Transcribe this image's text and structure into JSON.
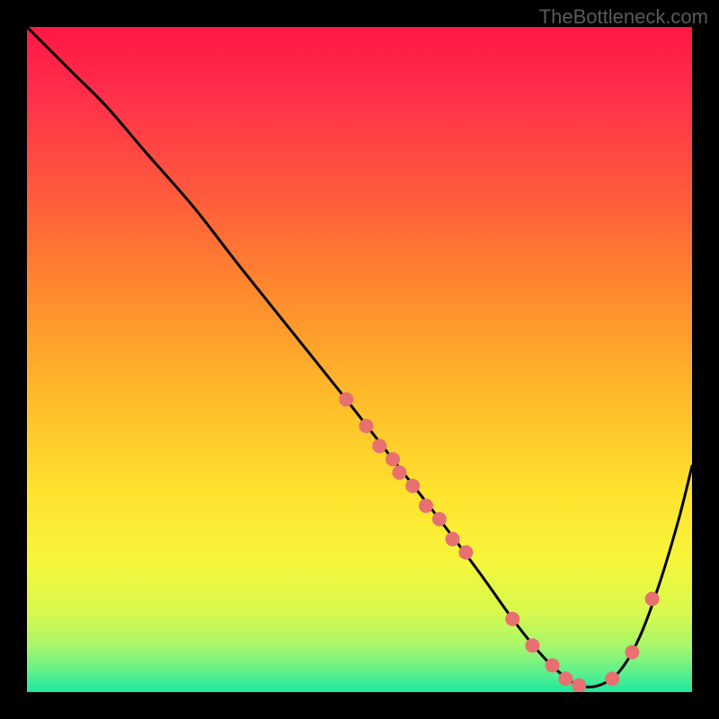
{
  "watermark": "TheBottleneck.com",
  "chart_data": {
    "type": "line",
    "title": "",
    "xlabel": "",
    "ylabel": "",
    "xlim": [
      0,
      100
    ],
    "ylim": [
      0,
      100
    ],
    "series": [
      {
        "name": "curve",
        "x": [
          0,
          3,
          7,
          12,
          18,
          25,
          32,
          40,
          48,
          55,
          62,
          68,
          73,
          77,
          80,
          83,
          86,
          89,
          92,
          95,
          98,
          100
        ],
        "y": [
          100,
          97,
          93,
          88,
          81,
          73,
          64,
          54,
          44,
          35,
          26,
          18,
          11,
          6,
          3,
          1,
          1,
          3,
          8,
          16,
          26,
          34
        ]
      }
    ],
    "markers": {
      "name": "highlight-points",
      "x": [
        48,
        51,
        53,
        55,
        56,
        58,
        60,
        62,
        64,
        66,
        73,
        76,
        79,
        81,
        83,
        88,
        91,
        94
      ],
      "y": [
        44,
        40,
        37,
        35,
        33,
        31,
        28,
        26,
        23,
        21,
        11,
        7,
        4,
        2,
        1,
        2,
        6,
        14
      ]
    },
    "gradient_stops": [
      {
        "offset": 0.0,
        "color": "#ff1744"
      },
      {
        "offset": 0.1,
        "color": "#ff2e4a"
      },
      {
        "offset": 0.25,
        "color": "#ff5a3c"
      },
      {
        "offset": 0.4,
        "color": "#ff8a2e"
      },
      {
        "offset": 0.55,
        "color": "#ffb92a"
      },
      {
        "offset": 0.7,
        "color": "#ffe22e"
      },
      {
        "offset": 0.8,
        "color": "#f7f53a"
      },
      {
        "offset": 0.88,
        "color": "#d8f94e"
      },
      {
        "offset": 0.93,
        "color": "#a8f76a"
      },
      {
        "offset": 0.97,
        "color": "#5ef08c"
      },
      {
        "offset": 1.0,
        "color": "#1ee8a0"
      }
    ],
    "marker_color": "#e87070",
    "curve_color": "#000000"
  }
}
